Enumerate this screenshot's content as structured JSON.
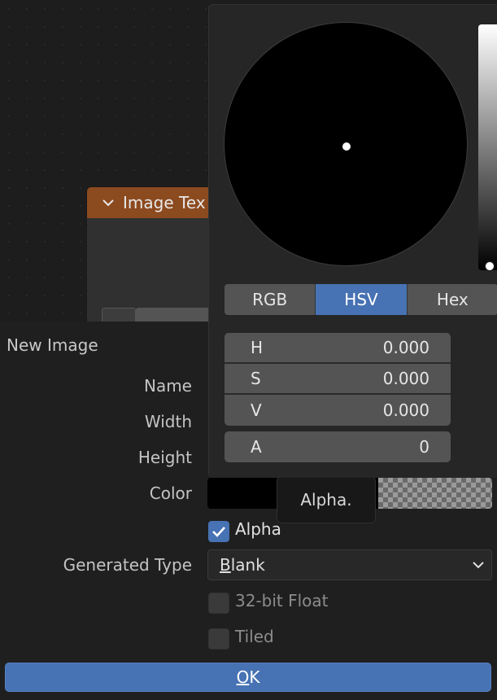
{
  "node": {
    "title": "Image Tex",
    "icon": "chevron-down-icon",
    "header_color": "#8c4a1f"
  },
  "dialog": {
    "title": "New Image",
    "labels": {
      "name": "Name",
      "width": "Width",
      "height": "Height",
      "color": "Color",
      "generated_type": "Generated Type"
    },
    "alpha": {
      "label": "Alpha",
      "checked": true
    },
    "generated_type_value": {
      "first": "B",
      "rest": "lank"
    },
    "float_32": {
      "label": "32-bit Float",
      "checked": false
    },
    "tiled": {
      "label": "Tiled",
      "checked": false
    },
    "ok": {
      "first": "O",
      "rest": "K"
    },
    "tooltip": "Alpha.",
    "accent": "#4772b3"
  },
  "picker": {
    "tabs": [
      "RGB",
      "HSV",
      "Hex"
    ],
    "active_tab": "HSV",
    "fields": [
      {
        "label": "H",
        "value": "0.000"
      },
      {
        "label": "S",
        "value": "0.000"
      },
      {
        "label": "V",
        "value": "0.000"
      }
    ],
    "alpha": {
      "label": "A",
      "value": "0"
    }
  }
}
